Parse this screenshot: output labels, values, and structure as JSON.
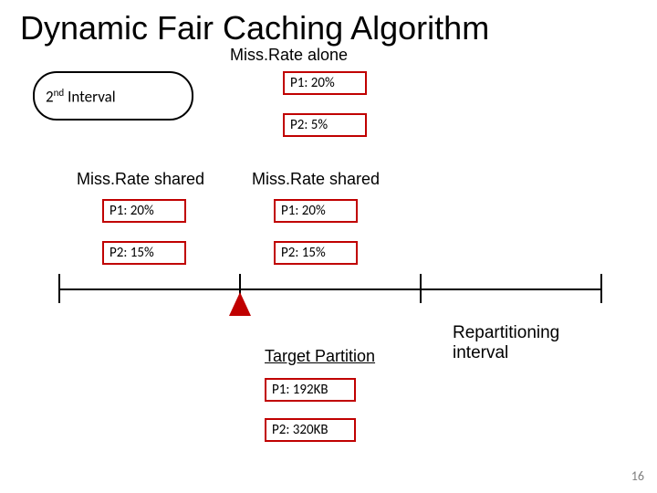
{
  "title": "Dynamic Fair Caching Algorithm",
  "miss_rate_alone": {
    "label": "Miss.Rate alone",
    "p1": "P1: 20%",
    "p2": "P2: 5%"
  },
  "interval": {
    "ordinal": "2",
    "suffix": "nd",
    "word": "Interval"
  },
  "shared_left": {
    "label": "Miss.Rate shared",
    "p1": "P1: 20%",
    "p2": "P2: 15%"
  },
  "shared_right": {
    "label": "Miss.Rate shared",
    "p1": "P1: 20%",
    "p2": "P2: 15%"
  },
  "target_partition": {
    "label": "Target Partition",
    "p1": "P1: 192KB",
    "p2": "P2: 320KB"
  },
  "repartitioning": {
    "line1": "Repartitioning",
    "line2": "interval"
  },
  "page_number": "16"
}
